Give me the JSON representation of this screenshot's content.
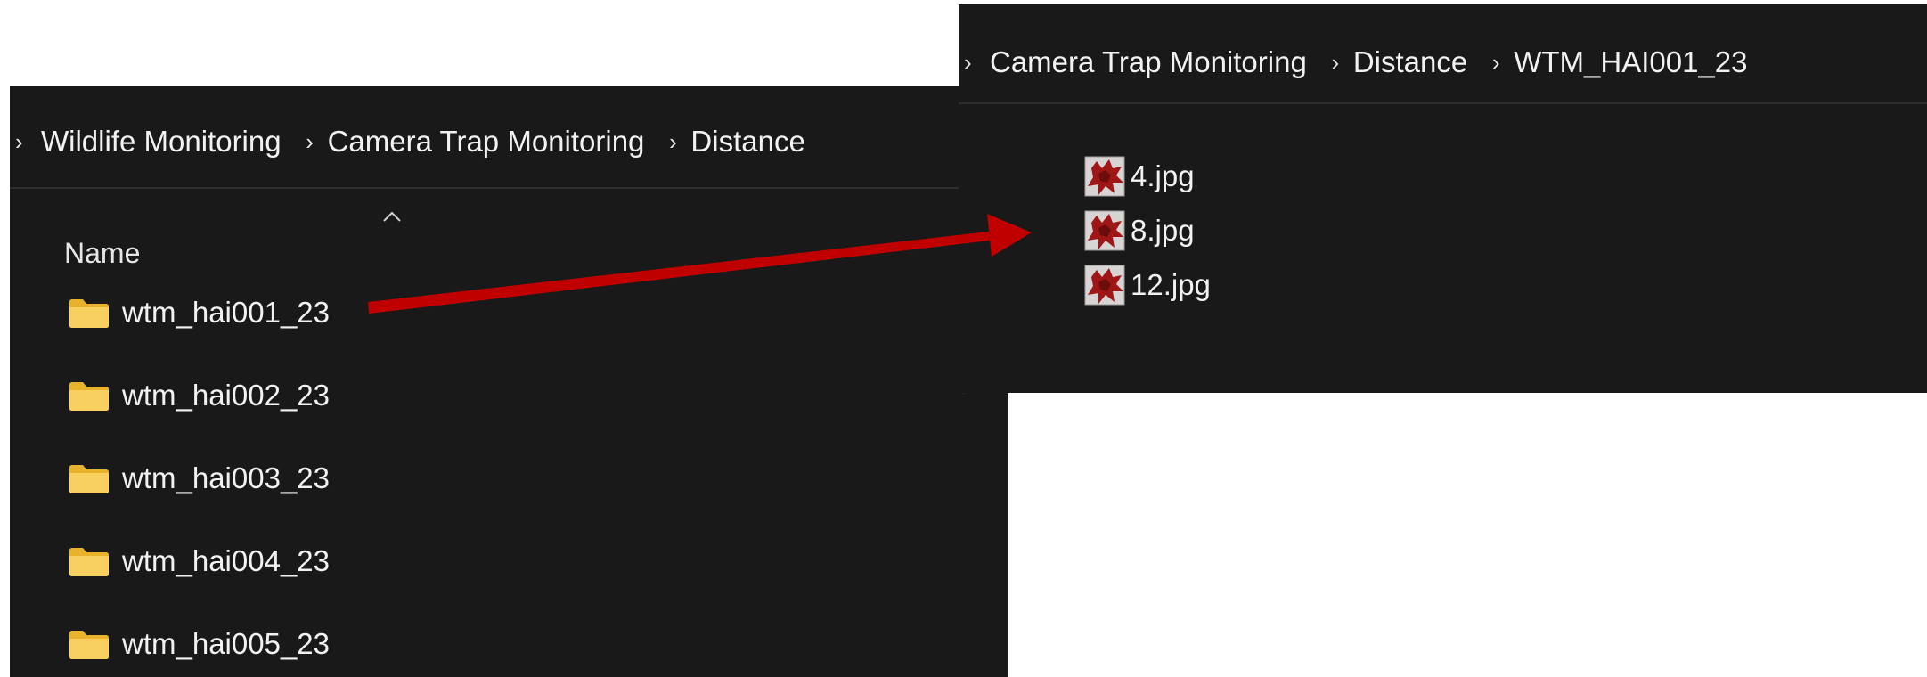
{
  "left_window": {
    "breadcrumb": [
      "Wildlife Monitoring",
      "Camera Trap Monitoring",
      "Distance"
    ],
    "column_header": "Name",
    "folders": [
      "wtm_hai001_23",
      "wtm_hai002_23",
      "wtm_hai003_23",
      "wtm_hai004_23",
      "wtm_hai005_23"
    ]
  },
  "right_window": {
    "breadcrumb": [
      "Camera Trap Monitoring",
      "Distance",
      "WTM_HAI001_23"
    ],
    "files": [
      "4.jpg",
      "8.jpg",
      "12.jpg"
    ]
  },
  "icons": {
    "breadcrumb_separator": "chevron-right-icon",
    "folder": "folder-icon",
    "image_file": "image-file-icon",
    "sort": "sort-ascending-caret-icon",
    "annotation": "arrow-annotation-icon"
  },
  "colors": {
    "panel_background": "#191919",
    "folder": "#F4C430",
    "arrow": "#C00000",
    "text": "#F2F2F2"
  }
}
